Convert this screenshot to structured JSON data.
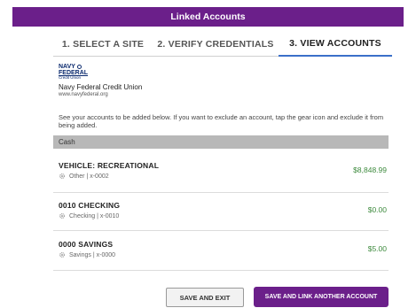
{
  "header": {
    "title": "Linked Accounts"
  },
  "steps": [
    {
      "label": "1. SELECT A SITE"
    },
    {
      "label": "2. VERIFY CREDENTIALS"
    },
    {
      "label": "3. VIEW ACCOUNTS"
    }
  ],
  "bank": {
    "logo": {
      "line1": "NAVY",
      "line2": "FEDERAL",
      "line3": "Credit Union"
    },
    "name": "Navy Federal Credit Union",
    "url": "www.navyfederal.org"
  },
  "note": "See your accounts to be added below. If you want to exclude an account, tap the gear icon and exclude it from being added.",
  "section": {
    "label": "Cash"
  },
  "accounts": [
    {
      "name": "VEHICLE: RECREATIONAL",
      "sub": "Other | x-0002",
      "balance": "$8,848.99"
    },
    {
      "name": "0010 CHECKING",
      "sub": "Checking | x-0010",
      "balance": "$0.00"
    },
    {
      "name": "0000 SAVINGS",
      "sub": "Savings | x-0000",
      "balance": "$5.00"
    }
  ],
  "buttons": {
    "save_exit": "SAVE AND EXIT",
    "save_link": "SAVE AND LINK ANOTHER ACCOUNT"
  },
  "colors": {
    "brand": "#6b1f8a",
    "balance": "#3d8a3d",
    "active_step": "#3b6fc9"
  },
  "icons": {
    "account_settings": "gear-icon"
  }
}
